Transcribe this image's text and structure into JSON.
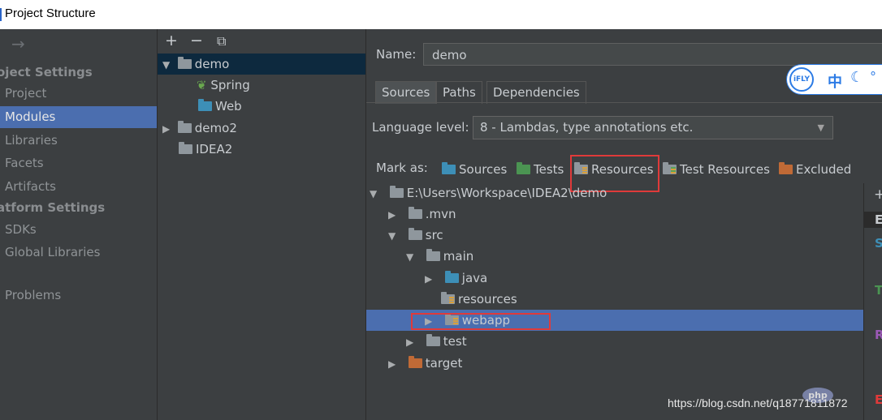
{
  "window": {
    "title": "Project Structure"
  },
  "nav": {
    "back_icon": "arrow-right-icon",
    "sections": [
      {
        "label": "oject Settings"
      },
      {
        "label": "atform Settings"
      }
    ],
    "items": [
      {
        "label": "Project"
      },
      {
        "label": "Modules"
      },
      {
        "label": "Libraries"
      },
      {
        "label": "Facets"
      },
      {
        "label": "Artifacts"
      },
      {
        "label": "SDKs"
      },
      {
        "label": "Global Libraries"
      },
      {
        "label": "Problems"
      }
    ]
  },
  "modules": {
    "toolbar": {
      "add": "+",
      "remove": "−",
      "copy": "⧉"
    },
    "tree": [
      {
        "label": "demo"
      },
      {
        "label": "Spring"
      },
      {
        "label": "Web"
      },
      {
        "label": "demo2"
      },
      {
        "label": "IDEA2"
      }
    ]
  },
  "detail": {
    "name_label": "Name:",
    "name_value": "demo",
    "tabs": [
      {
        "label": "Sources"
      },
      {
        "label": "Paths"
      },
      {
        "label": "Dependencies"
      }
    ],
    "language_level_label": "Language level:",
    "language_level_value": "8 - Lambdas, type annotations etc.",
    "mark_as_label": "Mark as:",
    "mark_buttons": [
      {
        "label": "Sources"
      },
      {
        "label": "Tests"
      },
      {
        "label": "Resources"
      },
      {
        "label": "Test Resources"
      },
      {
        "label": "Excluded"
      }
    ],
    "folder_tree": [
      {
        "label": "E:\\Users\\Workspace\\IDEA2\\demo"
      },
      {
        "label": ".mvn"
      },
      {
        "label": "src"
      },
      {
        "label": "main"
      },
      {
        "label": "java"
      },
      {
        "label": "resources"
      },
      {
        "label": "webapp"
      },
      {
        "label": "test"
      },
      {
        "label": "target"
      }
    ],
    "side_letters": [
      "+",
      "E",
      "S",
      "T",
      "R",
      "E"
    ]
  },
  "overlay": {
    "ifly_logo": "iFLY",
    "ifly_zh": "中",
    "ifly_moon": "☾",
    "ifly_dot": "°",
    "watermark": "https://blog.csdn.net/q18771811872",
    "php_logo": "php"
  },
  "colors": {
    "selection": "#4b6eaf",
    "highlight_box": "#e03a3a",
    "sources_folder": "#3d8fb7",
    "tests_folder": "#4b9452",
    "excluded_folder": "#c06a36"
  }
}
